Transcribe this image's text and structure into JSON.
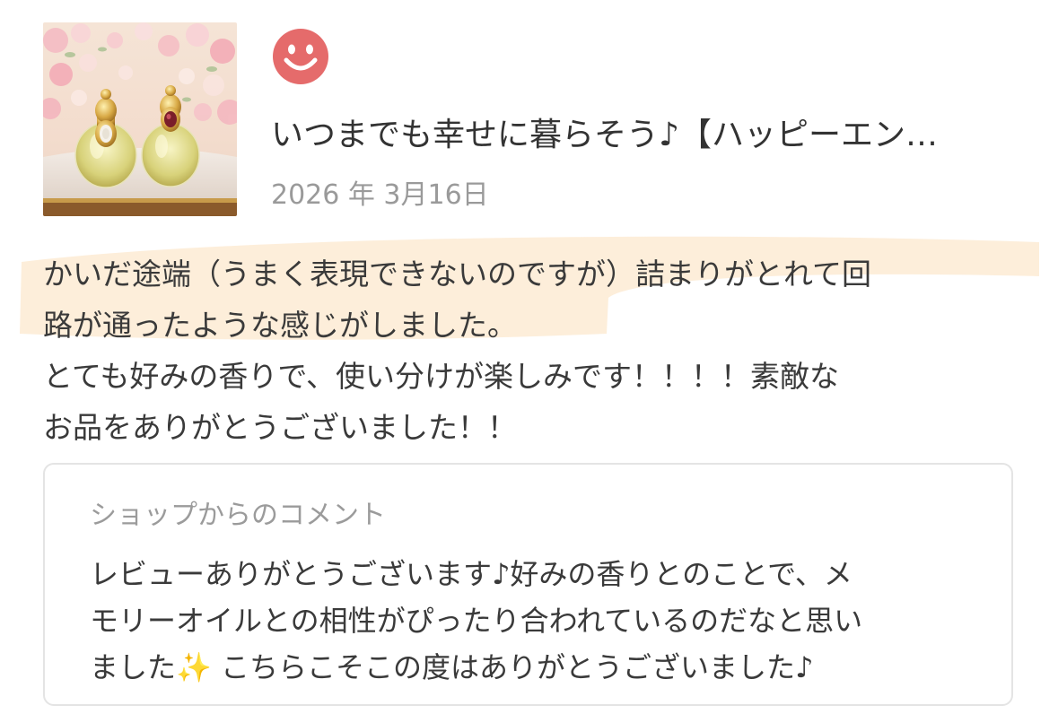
{
  "product": {
    "thumbnail_alt": "product-photo-perfume-bottles",
    "title": "いつまでも幸せに暮らそう♪【ハッピーエン…"
  },
  "review": {
    "rating_icon": "smile-face-icon",
    "rating_color": "#e56b6b",
    "date": "2026 年 3月16日",
    "highlight_color": "#fdebd3",
    "lines": [
      "かいだ途端（うまく表現できないのですが）詰まりがとれて回",
      "路が通ったような感じがしました。",
      "とても好みの香りで、使い分けが楽しみです！！！！素敵な",
      "お品をありがとうございました！！"
    ]
  },
  "shop_comment": {
    "title": "ショップからのコメント",
    "lines": [
      "レビューありがとうございます♪好みの香りとのことで、メ",
      "モリーオイルとの相性がぴったり合われているのだなと思い",
      "ました✨ こちらこそこの度はありがとうございました♪"
    ]
  }
}
